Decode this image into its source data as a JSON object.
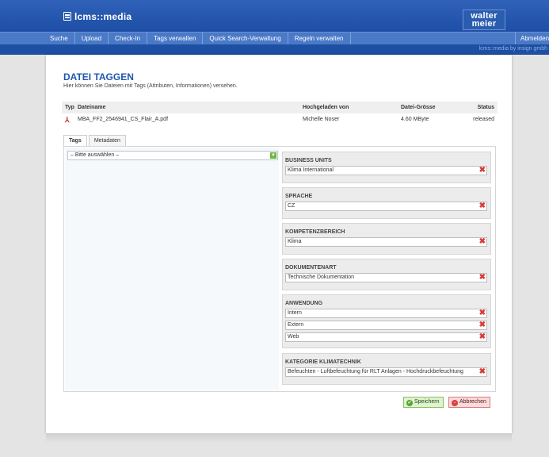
{
  "app": {
    "name": "lcms::media",
    "brand_logo": "walter\nmeier",
    "credit": "lcms::media by insign gmbh"
  },
  "nav": {
    "items": [
      "Suche",
      "Upload",
      "Check-In",
      "Tags verwalten",
      "Quick Search-Verwaltung",
      "Regeln verwalten"
    ],
    "logout": "Abmelden"
  },
  "page": {
    "title": "DATEI TAGGEN",
    "subtitle": "Hier können Sie Dateien mit Tags (Attributen, Informationen) versehen."
  },
  "file_table": {
    "headers": {
      "typ": "Typ",
      "name": "Dateiname",
      "user": "Hochgeladen von",
      "size": "Datei-Grösse",
      "status": "Status"
    },
    "row": {
      "type_icon": "pdf-icon",
      "name": "MBA_FF2_2546941_CS_Flair_A.pdf",
      "user": "Michelle Noser",
      "size": "4.60 MByte",
      "status": "released"
    }
  },
  "tabs": [
    "Tags",
    "Metadaten"
  ],
  "select": {
    "value": "– Bitte auswählen –"
  },
  "tag_groups": [
    {
      "title": "BUSINESS UNITS",
      "values": [
        "Klima International"
      ]
    },
    {
      "title": "SPRACHE",
      "values": [
        "CZ"
      ]
    },
    {
      "title": "KOMPETENZBEREICH",
      "values": [
        "Klima"
      ]
    },
    {
      "title": "DOKUMENTENART",
      "values": [
        "Technische Dokumentation"
      ]
    },
    {
      "title": "ANWENDUNG",
      "values": [
        "Intern",
        "Extern",
        "Web"
      ]
    },
    {
      "title": "KATEGORIE KLIMATECHNIK",
      "values": [
        "Befeuchten - Luftbefeuchtung für RLT Anlagen - Hochdruckbefeuchtung"
      ]
    }
  ],
  "buttons": {
    "save": "Speichern",
    "cancel": "Abbrechen"
  },
  "colors": {
    "brand_blue": "#1f56ad",
    "nav_blue": "#4a79c7",
    "remove_red": "#d83a3a",
    "save_green": "#58a62c"
  }
}
